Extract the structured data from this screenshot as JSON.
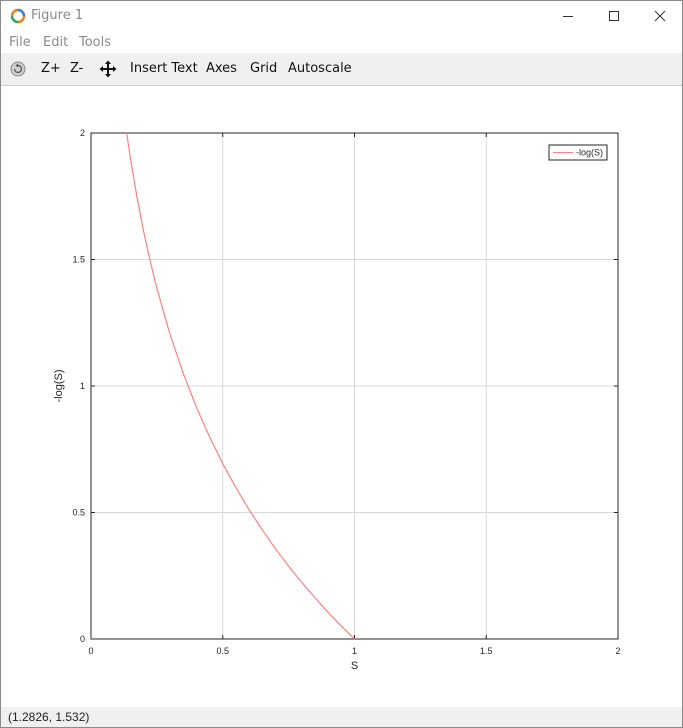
{
  "window": {
    "title": "Figure 1"
  },
  "menu": {
    "items": [
      "File",
      "Edit",
      "Tools"
    ]
  },
  "toolbar": {
    "zoom_in_label": "Z+",
    "zoom_out_label": "Z-",
    "insert_text_label": "Insert Text",
    "axes_label": "Axes",
    "grid_label": "Grid",
    "autoscale_label": "Autoscale"
  },
  "status": {
    "coordinates": "(1.2826, 1.532)"
  },
  "colors": {
    "curve": "#ff8080",
    "grid": "#d9d9d9",
    "axis": "#262626"
  },
  "chart_data": {
    "type": "line",
    "title": "",
    "xlabel": "S",
    "ylabel": "-log(S)",
    "xlim": [
      0,
      2
    ],
    "ylim": [
      0,
      2
    ],
    "xticks": [
      "0",
      "0.5",
      "1",
      "1.5",
      "2"
    ],
    "yticks": [
      "0",
      "0.5",
      "1",
      "1.5",
      "2"
    ],
    "grid": true,
    "legend_position": "top-right",
    "series": [
      {
        "name": "-log(S)",
        "color": "#ff8080",
        "x": [
          0.1353,
          0.15,
          0.175,
          0.2,
          0.225,
          0.25,
          0.3,
          0.35,
          0.4,
          0.45,
          0.5,
          0.55,
          0.6,
          0.65,
          0.7,
          0.75,
          0.8,
          0.85,
          0.9,
          0.95,
          1.0
        ],
        "y": [
          2.0,
          1.897,
          1.743,
          1.609,
          1.492,
          1.386,
          1.204,
          1.05,
          0.916,
          0.799,
          0.693,
          0.598,
          0.511,
          0.431,
          0.357,
          0.288,
          0.223,
          0.163,
          0.105,
          0.051,
          0.0
        ]
      }
    ]
  }
}
